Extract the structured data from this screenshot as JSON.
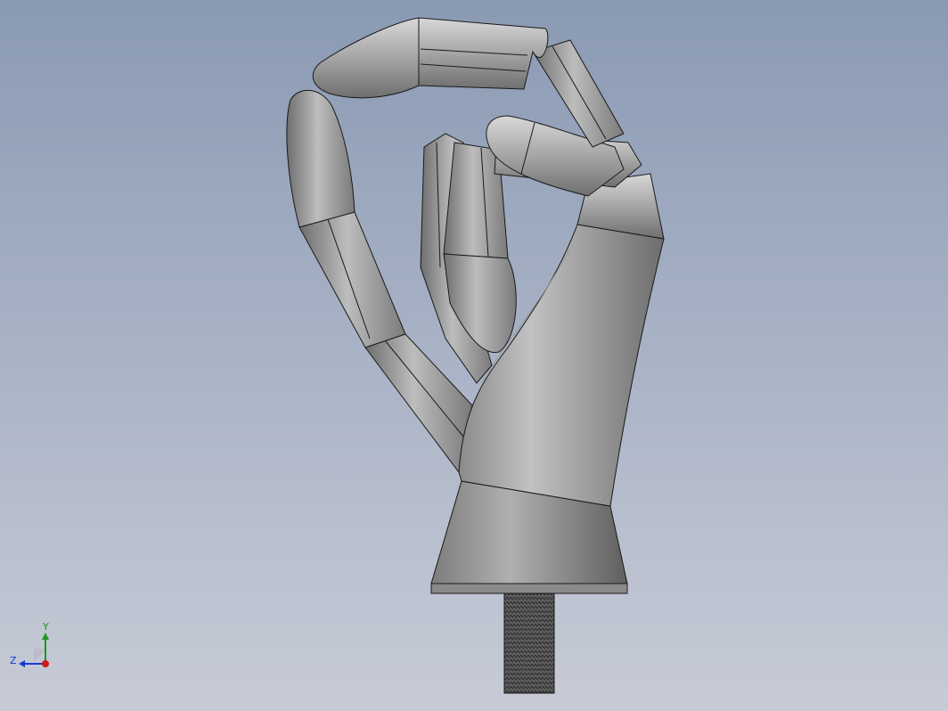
{
  "viewport": {
    "background_top": "#8a9ab3",
    "background_bottom": "#c7cbd6"
  },
  "model": {
    "part_color": "#9c9c9c",
    "edge_color": "#1a1a1a"
  },
  "triad": {
    "y_label": "Y",
    "z_label": "Z",
    "y_color": "#1a9a1a",
    "z_color": "#1a3ad0",
    "x_color": "#d01a1a"
  }
}
